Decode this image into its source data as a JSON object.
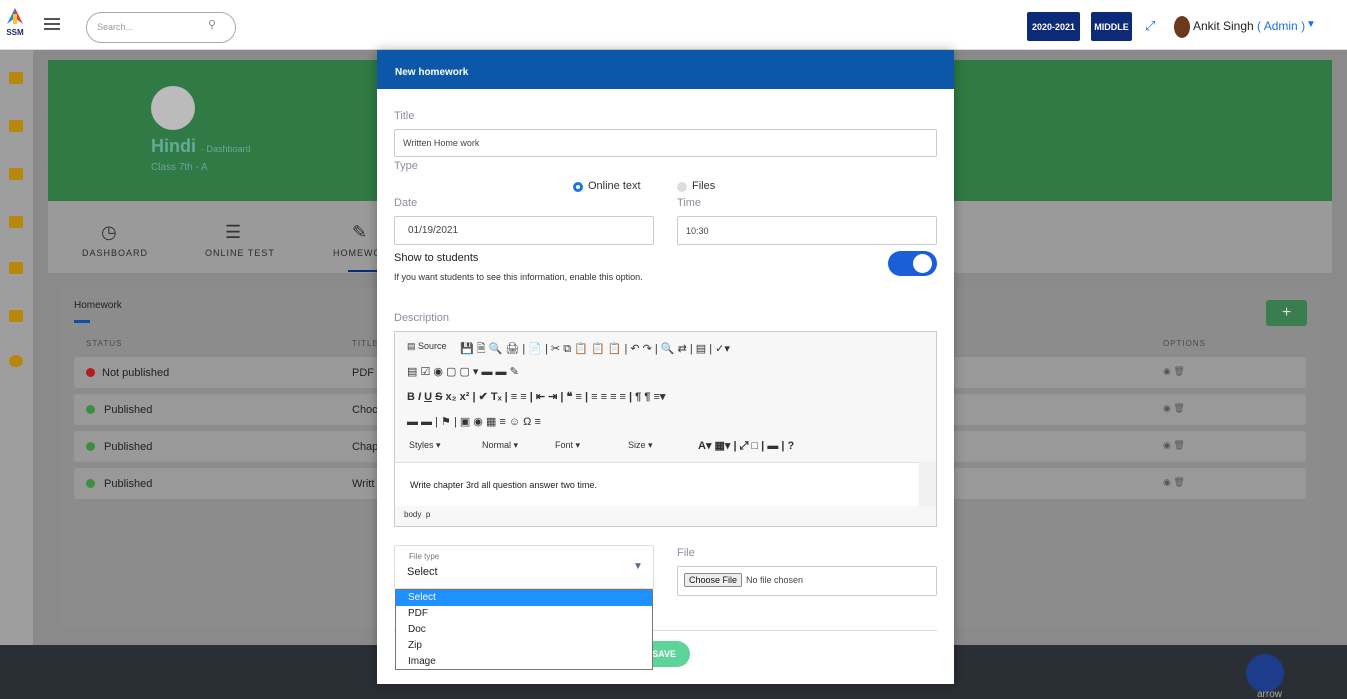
{
  "header": {
    "logo_text": "SSM",
    "search_placeholder": "Search...",
    "year_badge": "2020-2021",
    "level_badge": "MIDDLE",
    "user_name": "Ankit Singh",
    "user_role": "( Admin )"
  },
  "subject": {
    "title": "Hindi",
    "breadcrumb": "- Dashboard",
    "class": "Class 7th - A"
  },
  "tabs": [
    {
      "label": "DASHBOARD"
    },
    {
      "label": "ONLINE TEST"
    },
    {
      "label": "HOMEWO"
    }
  ],
  "homework_list": {
    "title": "Homework",
    "add_label": "+",
    "columns": {
      "status": "STATUS",
      "title": "TITLE",
      "options": "OPTIONS"
    },
    "rows": [
      {
        "status": "Not published",
        "title": "PDF H",
        "status_color": "#d32f2f"
      },
      {
        "status": "Published",
        "title": "Choc",
        "status_color": "#4caf50"
      },
      {
        "status": "Published",
        "title": "Chap",
        "status_color": "#4caf50"
      },
      {
        "status": "Published",
        "title": "Writt",
        "status_color": "#4caf50"
      }
    ]
  },
  "modal": {
    "header": "New homework",
    "title_label": "Title",
    "title_value": "Written Home work",
    "type_label": "Type",
    "type_options": [
      "Online text",
      "Files"
    ],
    "type_selected": "Online text",
    "date_label": "Date",
    "date_value": "01/19/2021",
    "time_label": "Time",
    "time_value": "10:30",
    "show_students_label": "Show to students",
    "show_students_help": "If you want students to see this information, enable this option.",
    "show_students_enabled": true,
    "description_label": "Description",
    "editor": {
      "source_label": "Source",
      "styles_label": "Styles",
      "format_label": "Normal",
      "font_label": "Font",
      "size_label": "Size",
      "content": "Write chapter 3rd all question answer two time.",
      "path_body": "body",
      "path_p": "p"
    },
    "file_type_label": "File type",
    "file_type_value": "Select",
    "file_type_options": [
      "Select",
      "PDF",
      "Doc",
      "Zip",
      "Image"
    ],
    "file_label": "File",
    "choose_file_label": "Choose File",
    "no_file_label": "No file chosen",
    "save_label": "SAVE"
  },
  "footer": {
    "arrow_label": "arrow"
  },
  "colors": {
    "primary": "#0d57a8",
    "accent": "#1a5ed8",
    "badge": "#0d2a78",
    "save": "#5fd49a",
    "banner": "#2f7a45"
  }
}
